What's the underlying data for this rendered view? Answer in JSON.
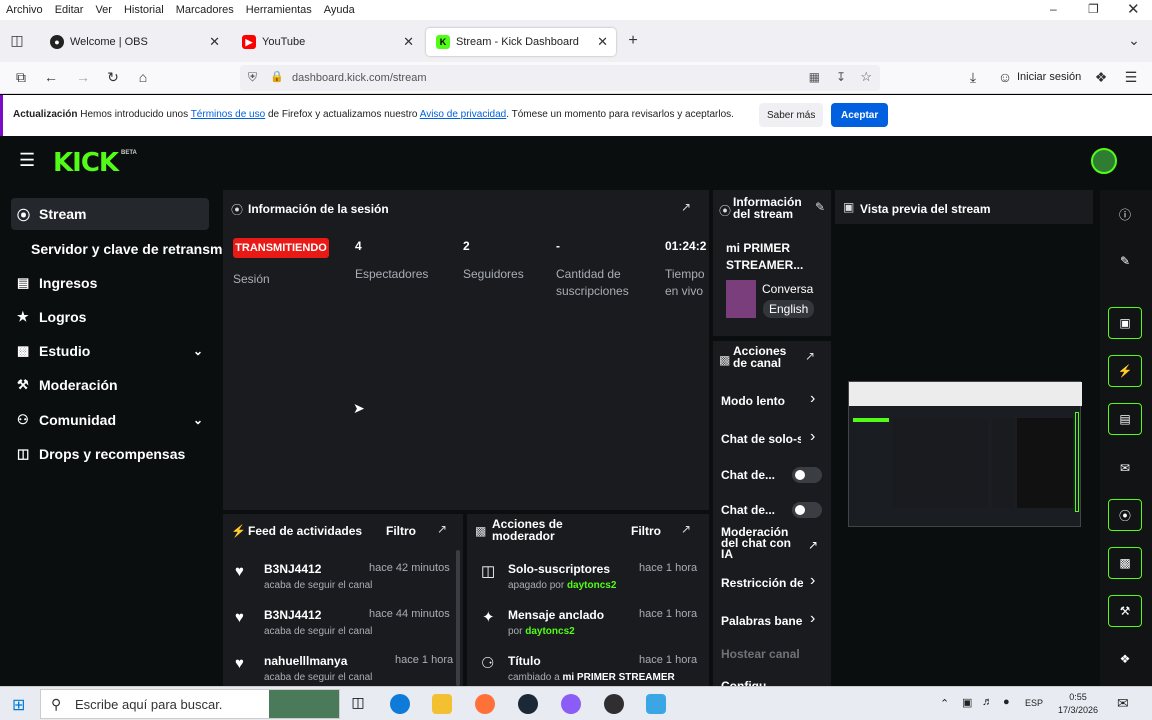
{
  "menubar": {
    "items": [
      "Archivo",
      "Editar",
      "Ver",
      "Historial",
      "Marcadores",
      "Herramientas",
      "Ayuda"
    ]
  },
  "tabs": [
    {
      "label": "Welcome | OBS",
      "fav_color": "#222"
    },
    {
      "label": "YouTube",
      "fav_color": "#ff0000"
    },
    {
      "label": "Stream - Kick Dashboard",
      "fav_color": "#53fc18"
    }
  ],
  "navbar": {
    "url": "dashboard.kick.com/stream",
    "signin_label": "Iniciar sesión"
  },
  "notice": {
    "prefix": "Actualización",
    "text_1": " Hemos introducido unos ",
    "link_1": "Términos de uso",
    "text_2": " de Firefox y actualizamos nuestro ",
    "link_2": "Aviso de privacidad",
    "text_3": ". Tómese un momento para revisarlos y aceptarlos.",
    "learn_more": "Saber más",
    "accept": "Aceptar"
  },
  "kick": {
    "logo": "KICK",
    "beta": "BETA"
  },
  "sidebar": {
    "items": [
      {
        "label": "Stream",
        "icon": "broadcast-icon"
      },
      {
        "label": "Servidor y clave de retransm",
        "icon": ""
      },
      {
        "label": "Ingresos",
        "icon": "bar-chart-icon"
      },
      {
        "label": "Logros",
        "icon": "trophy-icon"
      },
      {
        "label": "Estudio",
        "icon": "studio-icon"
      },
      {
        "label": "Moderación",
        "icon": "wrench-icon"
      },
      {
        "label": "Comunidad",
        "icon": "users-icon"
      },
      {
        "label": "Drops y recompensas",
        "icon": "gift-icon"
      }
    ]
  },
  "session": {
    "title": "Información de la sesión",
    "status_badge": "TRANSMITIENDO",
    "session_label": "Sesión",
    "viewers_value": "4",
    "viewers_label": "Espectadores",
    "followers_value": "2",
    "followers_label": "Seguidores",
    "subs_value": "-",
    "subs_label": "Cantidad de suscripciones",
    "time_value": "01:24:2",
    "time_label": "Tiempo en vivo"
  },
  "stream_info": {
    "title": "Información del stream",
    "stream_title": "mi PRIMER STREAMER...",
    "category": "Conversa",
    "language": "English"
  },
  "preview": {
    "title": "Vista previa del stream"
  },
  "activity": {
    "title": "Feed de actividades",
    "filter": "Filtro",
    "items": [
      {
        "name": "B3NJ4412",
        "time": "hace 42 minutos",
        "text": "acaba de seguir el canal"
      },
      {
        "name": "B3NJ4412",
        "time": "hace 44 minutos",
        "text": "acaba de seguir el canal"
      },
      {
        "name": "nahuelllmanya",
        "time": "hace 1 hora",
        "text": "acaba de seguir el canal"
      }
    ]
  },
  "mod_actions": {
    "title": "Acciones de moderador",
    "filter": "Filtro",
    "items": [
      {
        "name": "Solo-suscriptores",
        "time": "hace 1 hora",
        "sub_prefix": "apagado por ",
        "user": "daytoncs2"
      },
      {
        "name": "Mensaje anclado",
        "time": "hace 1 hora",
        "sub_prefix": "por ",
        "user": "daytoncs2"
      },
      {
        "name": "Título",
        "time": "hace 1 hora",
        "sub_prefix": "cambiado a ",
        "user": "mi PRIMER STREAMER"
      }
    ]
  },
  "channel_actions": {
    "title": "Acciones de canal",
    "slow_mode": "Modo lento",
    "subs_only": "Chat de solo-s",
    "chat_1": "Chat de...",
    "chat_2": "Chat de...",
    "ai_mod": "Moderación del chat con IA",
    "restriction": "Restricción de",
    "banned_words": "Palabras bane",
    "host": "Hostear canal",
    "more": "Configu"
  },
  "taskbar": {
    "search_placeholder": "Escribe aquí para buscar.",
    "lang": "ESP",
    "time": "0:55",
    "date": "17/3/2026"
  }
}
